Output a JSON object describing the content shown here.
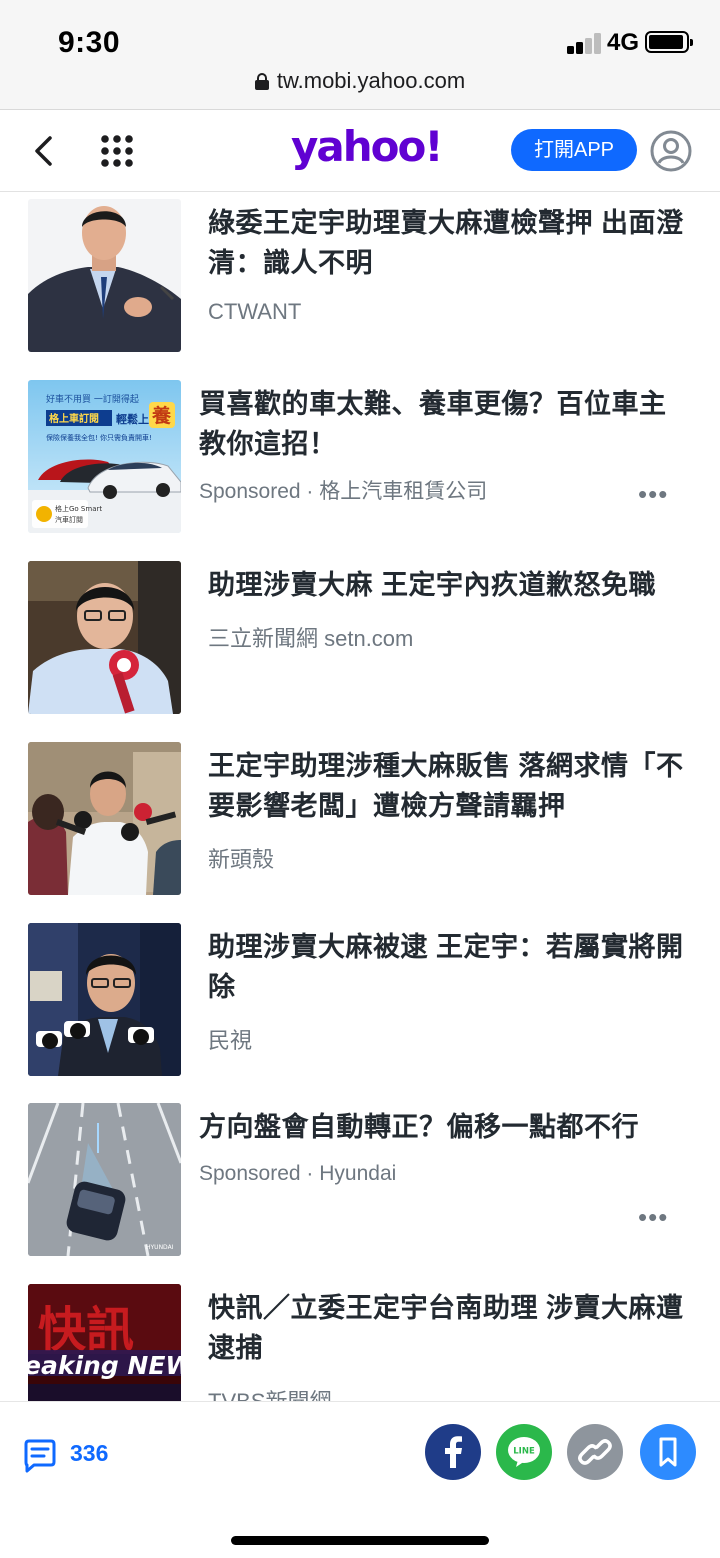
{
  "status_bar": {
    "time": "9:30",
    "network": "4G",
    "url": "tw.mobi.yahoo.com"
  },
  "header": {
    "logo": "yahoo!",
    "open_app_label": "打開APP"
  },
  "articles": [
    {
      "title": "綠委王定宇助理賣大麻遭檢聲押 出面澄清：識人不明",
      "source": "CTWANT",
      "sponsored": false
    },
    {
      "title": "買喜歡的車太難、養車更傷？百位車主教你這招！",
      "source": "Sponsored · 格上汽車租賃公司",
      "sponsored": true,
      "more_label": "•••",
      "thumb_text": [
        "好車不用買 一訂開得起",
        "格上車訂閱",
        "輕鬆上",
        "養",
        "保險保養我全包! 你只需負責開車!",
        "格上Go Smart",
        "汽車訂閱"
      ]
    },
    {
      "title": "助理涉賣大麻 王定宇內疚道歉怒免職",
      "source": "三立新聞網 setn.com",
      "sponsored": false
    },
    {
      "title": "王定宇助理涉種大麻販售 落網求情「不要影響老闆」遭檢方聲請羈押",
      "source": "新頭殼",
      "sponsored": false
    },
    {
      "title": "助理涉賣大麻被逮 王定宇：若屬實將開除",
      "source": "民視",
      "sponsored": false
    },
    {
      "title": "方向盤會自動轉正？偏移一點都不行",
      "source": "Sponsored · Hyundai",
      "sponsored": true,
      "more_label": "•••",
      "thumb_text": [
        "HYUNDAI"
      ]
    },
    {
      "title": "快訊／立委王定宇台南助理 涉賣大麻遭逮捕",
      "source": "TVBS新聞網",
      "sponsored": false,
      "thumb_text": [
        "快訊",
        "eaking NEW"
      ]
    }
  ],
  "bottom_bar": {
    "comment_count": "336"
  },
  "colors": {
    "yahoo_purple": "#6001d2",
    "primary_blue": "#0f69ff",
    "facebook": "#1f3c88",
    "line": "#2bb84b"
  }
}
